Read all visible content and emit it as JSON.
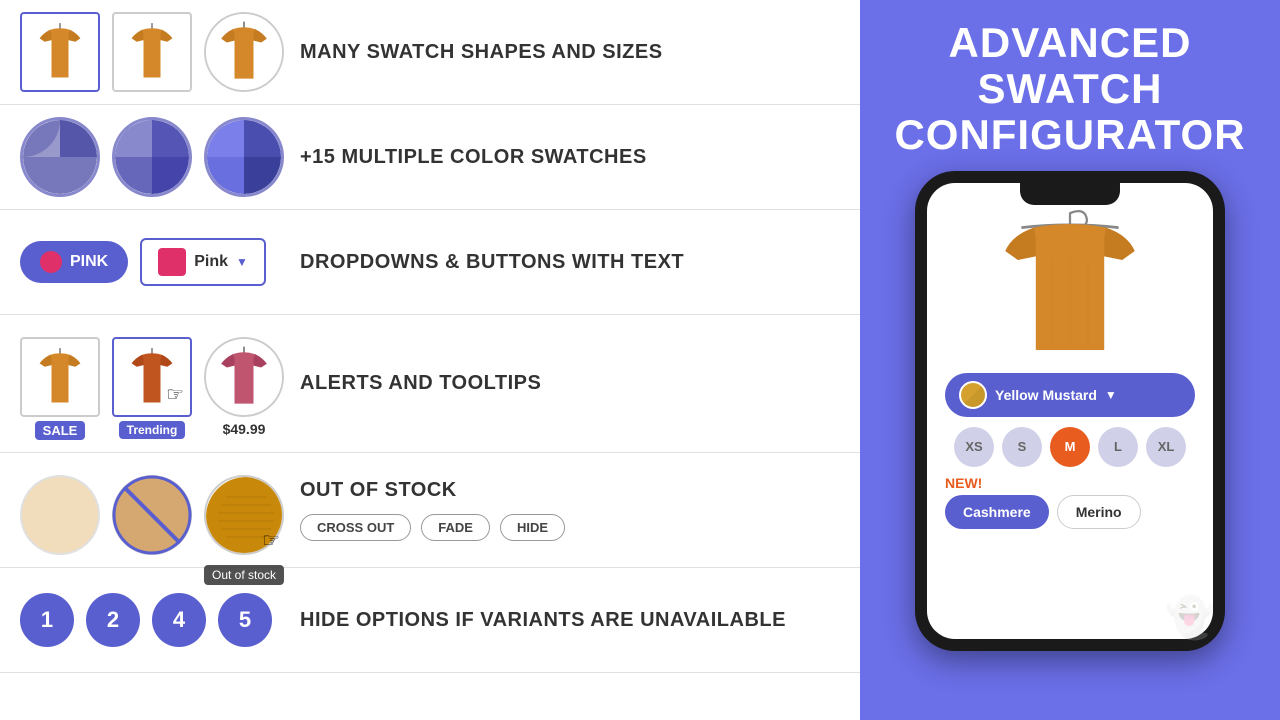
{
  "right": {
    "title_line1": "ADVANCED",
    "title_line2": "SWATCH",
    "title_line3": "CONFIGURATOR"
  },
  "rows": [
    {
      "id": "row1",
      "label": "MANY SWATCH SHAPES AND SIZES"
    },
    {
      "id": "row2",
      "label": "+15 MULTIPLE COLOR SWATCHES"
    },
    {
      "id": "row3",
      "label": "DROPDOWNS & BUTTONS WITH TEXT",
      "btn1": "PINK",
      "btn2": "Pink"
    },
    {
      "id": "row4",
      "label": "ALERTS AND TOOLTIPS",
      "badge1": "SALE",
      "badge2": "Trending",
      "price": "$49.99"
    },
    {
      "id": "row5",
      "label": "OUT OF STOCK",
      "tooltip": "Out of stock",
      "btn1": "CROSS OUT",
      "btn2": "FADE",
      "btn3": "HIDE"
    },
    {
      "id": "row6",
      "label": "HIDE OPTIONS IF VARIANTS ARE UNAVAILABLE",
      "nums": [
        "1",
        "2",
        "4",
        "5"
      ]
    }
  ],
  "phone": {
    "color_label": "Yellow Mustard",
    "sizes": [
      "XS",
      "S",
      "M",
      "L",
      "XL"
    ],
    "active_size": "M",
    "new_label": "NEW!",
    "material1": "Cashmere",
    "material2": "Merino"
  }
}
